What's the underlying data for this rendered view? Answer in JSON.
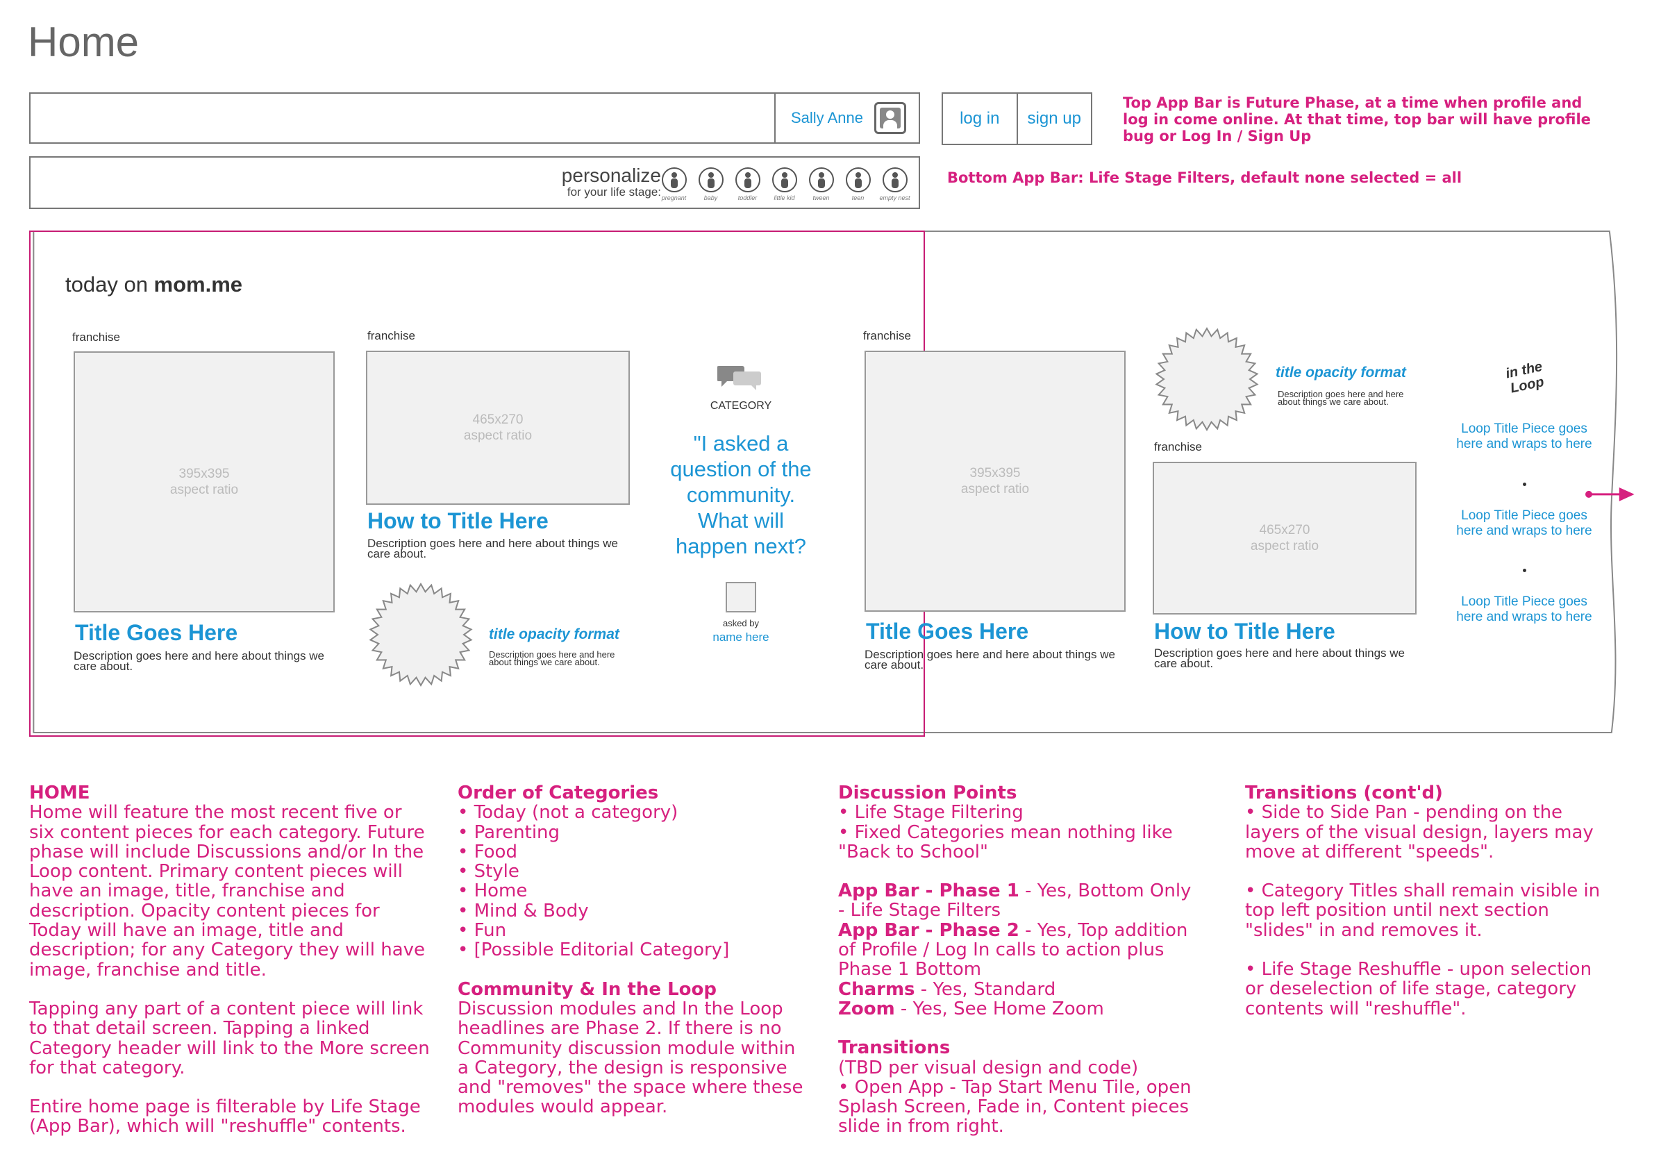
{
  "page": {
    "title": "Home"
  },
  "top_app_bar": {
    "profile_name": "Sally Anne",
    "login_label": "log in",
    "signup_label": "sign up"
  },
  "bottom_app_bar": {
    "personalize_title": "personalize",
    "personalize_subtitle": "for your life stage:",
    "life_stages": [
      "pregnant",
      "baby",
      "toddler",
      "little kid",
      "tween",
      "teen",
      "empty nest"
    ]
  },
  "annotations": {
    "top_bar_note": "Top App Bar is Future Phase, at a time when profile and log in come online. At that time, top bar will have profile bug or Log In / Sign Up",
    "bottom_bar_note": "Bottom App Bar: Life Stage Filters, default none selected = all"
  },
  "canvas": {
    "today_prefix": "today on ",
    "today_brand": "mom.me",
    "franchise_label": "franchise",
    "placeholder_square": {
      "size": "395x395",
      "ratio": "aspect ratio"
    },
    "placeholder_wide": {
      "size": "465x270",
      "ratio": "aspect ratio"
    },
    "title_goes_here": "Title Goes Here",
    "how_to_title": "How to Title Here",
    "description": "Description goes here and here about things we care about.",
    "opacity_title": "title opacity format",
    "opacity_desc": "Description goes here and here about things we care about.",
    "community": {
      "category_label": "CATEGORY",
      "quote": "\"I asked a question of the community. What will happen next?",
      "asked_by": "asked by",
      "name": "name here"
    },
    "loop": {
      "title": "in the Loop",
      "items": [
        "Loop Title Piece goes here and wraps to here",
        "Loop Title Piece goes here and wraps to here",
        "Loop Title Piece goes here and wraps to here"
      ]
    }
  },
  "notes": {
    "col1": {
      "heading": "HOME",
      "p1": "Home will feature the most recent five or six content pieces for each category. Future phase will include Discussions and/or In the Loop content. Primary content pieces will have an image, title, franchise and description. Opacity content pieces for Today will have an image, title and description; for any Category they will have image, franchise and title.",
      "p2": "Tapping any part of a content piece will link to that detail screen. Tapping a linked Category header will link to the More screen for that category.",
      "p3": "Entire home page is filterable by Life Stage (App Bar), which will \"reshuffle\" contents."
    },
    "col2": {
      "heading1": "Order of Categories",
      "items": [
        "• Today (not a category)",
        "• Parenting",
        "• Food",
        "• Style",
        "• Home",
        "• Mind & Body",
        "• Fun",
        "• [Possible Editorial Category]"
      ],
      "heading2": "Community & In the Loop",
      "p1": "Discussion modules and In the Loop headlines are Phase 2. If there is no Community discussion module within a Category, the design is responsive and \"removes\" the space where these modules would appear."
    },
    "col3": {
      "heading1": "Discussion Points",
      "items": [
        "• Life Stage Filtering",
        "• Fixed Categories mean nothing like \"Back to School\""
      ],
      "appbar1_label": "App Bar - Phase 1",
      "appbar1_text": " - Yes, Bottom Only - Life Stage Filters",
      "appbar2_label": "App Bar - Phase 2",
      "appbar2_text": " - Yes, Top addition of Profile / Log In calls to action plus Phase 1 Bottom",
      "charms_label": "Charms",
      "charms_text": " - Yes, Standard",
      "zoom_label": "Zoom",
      "zoom_text": " - Yes, See Home Zoom",
      "heading2": "Transitions",
      "trans_p1": "(TBD per visual design and code)",
      "trans_p2": "• Open App - Tap Start Menu Tile, open Splash Screen, Fade in, Content pieces slide in from right."
    },
    "col4": {
      "heading": "Transitions (cont'd)",
      "p1": "• Side to Side Pan - pending on the layers of the visual design, layers may move at different \"speeds\".",
      "p2": "• Category Titles shall remain visible in top left position until next section \"slides\" in and removes it.",
      "p3": "• Life Stage Reshuffle - upon selection or deselection of life stage, category contents will \"reshuffle\"."
    }
  },
  "colors": {
    "accent_blue": "#1c95d4",
    "annotation_pink": "#d6207f",
    "frame_pink": "#c71c74"
  }
}
